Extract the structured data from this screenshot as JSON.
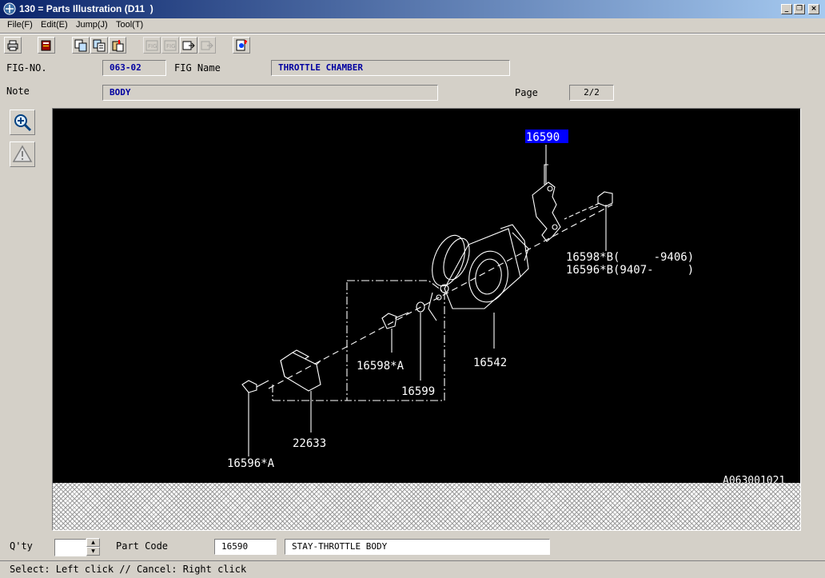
{
  "window": {
    "title": "130 = Parts Illustration (D11  )"
  },
  "menu": [
    "File(F)",
    "Edit(E)",
    "Jump(J)",
    "Tool(T)"
  ],
  "toolbar": {
    "icons": [
      "print-icon",
      "book-icon",
      "copy-icon",
      "copy-all-icon",
      "paste-icon",
      "fig-first-icon",
      "fig-prev-icon",
      "fig-next-icon",
      "fig-last-icon",
      "search-doc-icon"
    ]
  },
  "header": {
    "fig_no_label": "FIG-NO.",
    "fig_no_value": "063-02",
    "fig_name_label": "FIG Name",
    "fig_name_value": "THROTTLE CHAMBER",
    "note_label": "Note",
    "note_value": "BODY",
    "page_label": "Page",
    "page_value": "2/2"
  },
  "illustration": {
    "labels": {
      "p16590": "16590",
      "p16598b": "16598*B(     -9406)",
      "p16596b": "16596*B(9407-     )",
      "p16542": "16542",
      "p16598a": "16598*A",
      "p16599": "16599",
      "p22633": "22633",
      "p16596a": "16596*A",
      "drawing_id": "A063001021"
    },
    "selected_part": "16590",
    "colors": {
      "background": "#000000",
      "lines": "#ffffff",
      "selection": "#0000ff"
    }
  },
  "footer": {
    "qty_label": "Q'ty",
    "qty_value": "",
    "part_code_label": "Part Code",
    "part_code_value": "16590",
    "part_name_value": "STAY-THROTTLE BODY"
  },
  "status": "Select: Left click // Cancel: Right click"
}
